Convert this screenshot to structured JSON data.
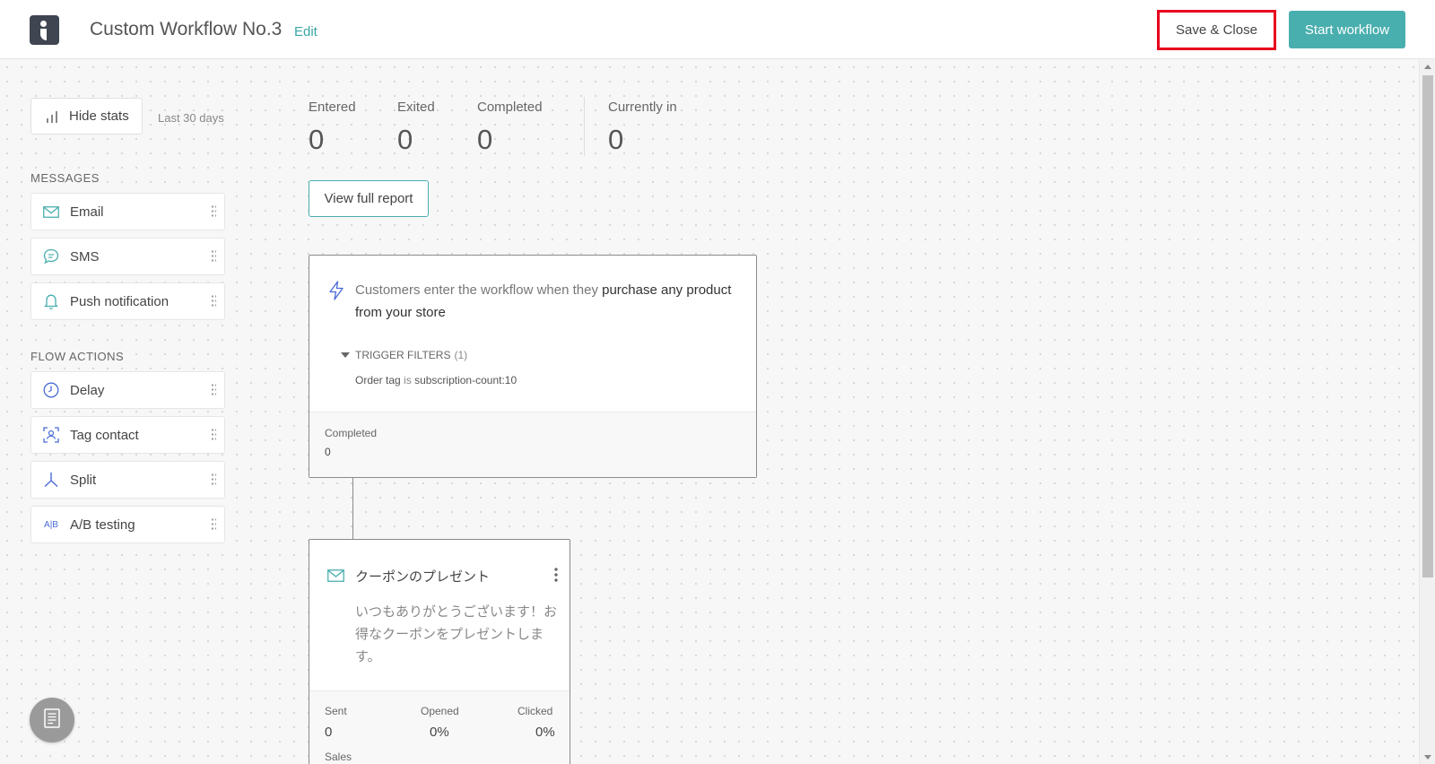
{
  "header": {
    "title": "Custom Workflow No.3",
    "edit_label": "Edit",
    "save_close_label": "Save & Close",
    "start_label": "Start workflow"
  },
  "colors": {
    "accent": "#49aeae",
    "highlight": "#e8001c",
    "logo": "#3f4651"
  },
  "stats_panel": {
    "hide_stats_label": "Hide stats",
    "period_label": "Last 30 days",
    "entered_label": "Entered",
    "entered_value": "0",
    "exited_label": "Exited",
    "exited_value": "0",
    "completed_label": "Completed",
    "completed_value": "0",
    "current_label": "Currently in",
    "current_value": "0",
    "report_label": "View full report"
  },
  "palette": {
    "messages_heading": "MESSAGES",
    "email": "Email",
    "sms": "SMS",
    "push": "Push notification",
    "flow_heading": "FLOW ACTIONS",
    "delay": "Delay",
    "tag": "Tag contact",
    "split": "Split",
    "ab": "A/B testing",
    "ab_icon_text": "A|B"
  },
  "trigger": {
    "text_pre": "Customers enter the workflow when they ",
    "text_bold": "purchase any product from your store",
    "filters_label": "TRIGGER FILTERS",
    "filters_count": "(1)",
    "filter_field": "Order tag",
    "filter_op": "is",
    "filter_value": "subscription-count:10",
    "completed_label": "Completed",
    "completed_value": "0"
  },
  "email_node": {
    "title": "クーポンのプレゼント",
    "body": "いつもありがとうございます！お得なクーポンをプレゼントします。",
    "sent_label": "Sent",
    "sent_value": "0",
    "opened_label": "Opened",
    "opened_value": "0%",
    "clicked_label": "Clicked",
    "clicked_value": "0%",
    "sales_label": "Sales"
  },
  "icons": [
    "logo-icon",
    "bar-chart-icon",
    "mail-icon",
    "chat-bubble-icon",
    "bell-icon",
    "clock-icon",
    "tag-contact-icon",
    "split-icon",
    "ab-testing-icon",
    "lightning-bolt-icon",
    "kebab-menu-icon",
    "document-icon",
    "drag-handle-icon"
  ]
}
